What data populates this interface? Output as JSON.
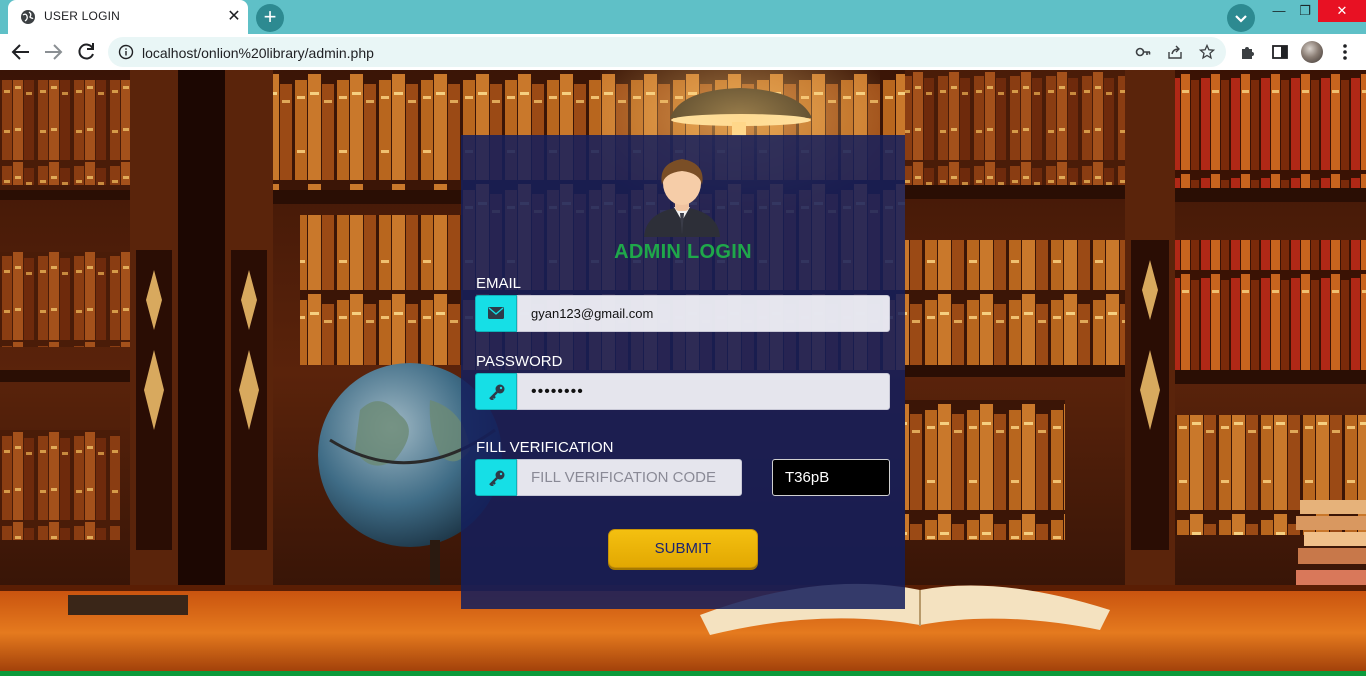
{
  "browser": {
    "tab_title": "USER LOGIN",
    "tab_close": "✕",
    "new_tab": "+",
    "url": "localhost/onlion%20library/admin.php",
    "icons": [
      "globe-icon",
      "close-icon",
      "plus-icon",
      "chevron-down-icon",
      "minimize-icon",
      "restore-icon",
      "close-icon",
      "back-icon",
      "forward-icon",
      "reload-icon",
      "info-icon",
      "key-icon",
      "share-icon",
      "star-icon",
      "extensions-icon",
      "side-panel-icon",
      "avatar",
      "menu-icon"
    ],
    "window_controls": {
      "minimize": "—",
      "restore": "❐",
      "close": "✕"
    }
  },
  "login": {
    "title": "ADMIN LOGIN",
    "email_label": "EMAIL",
    "email_value": "gyan123@gmail.com",
    "password_label": "PASSWORD",
    "password_value": "••••••••",
    "verify_label": "FILL VERIFICATION",
    "verify_placeholder": "FILL VERIFICATION CODE",
    "captcha": "T36pB",
    "submit_label": "SUBMIT"
  },
  "colors": {
    "tab_strip": "#5fc0c7",
    "card": "#141e5c",
    "title_green": "#1fa84a",
    "addon_cyan": "#16dfe6",
    "submit_yellow": "#f4c010",
    "bottom_line": "#0c9a3b"
  }
}
